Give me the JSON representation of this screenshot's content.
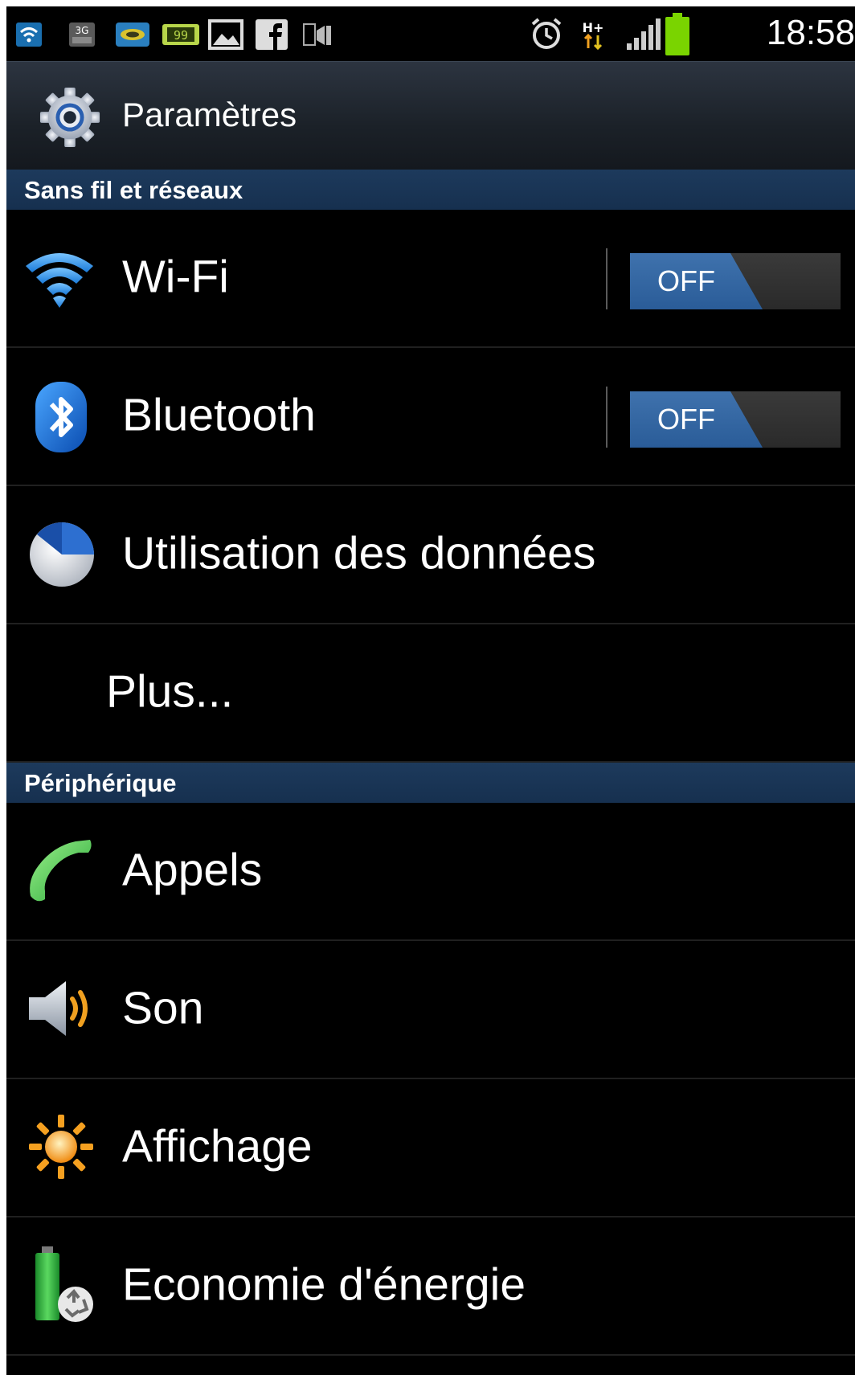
{
  "status_bar": {
    "time": "18:58",
    "icons": [
      "wifi-notification-icon",
      "3g-data-icon",
      "game-notification-icon",
      "battery-99-notification-icon",
      "image-notification-icon",
      "facebook-icon",
      "ftp-icon",
      "alarm-icon",
      "h-plus-data-icon",
      "signal-strength-icon",
      "battery-icon"
    ],
    "badge_3g": "3G",
    "badge_99": "99",
    "badge_hplus": "H+"
  },
  "titlebar": {
    "title": "Paramètres",
    "icon": "gear-icon"
  },
  "sections": [
    {
      "header": "Sans fil et réseaux",
      "items": [
        {
          "label": "Wi-Fi",
          "icon": "wifi-icon",
          "toggle": "OFF"
        },
        {
          "label": "Bluetooth",
          "icon": "bluetooth-icon",
          "toggle": "OFF"
        },
        {
          "label": "Utilisation des données",
          "icon": "pie-chart-icon"
        },
        {
          "label": "Plus..."
        }
      ]
    },
    {
      "header": "Périphérique",
      "items": [
        {
          "label": "Appels",
          "icon": "phone-icon"
        },
        {
          "label": "Son",
          "icon": "speaker-icon"
        },
        {
          "label": "Affichage",
          "icon": "sun-icon"
        },
        {
          "label": "Economie d'énergie",
          "icon": "battery-recycle-icon"
        }
      ]
    }
  ],
  "colors": {
    "section_header": "#1d3a5c",
    "toggle_on_part": "#2a5c98",
    "battery_green": "#7ad400"
  }
}
